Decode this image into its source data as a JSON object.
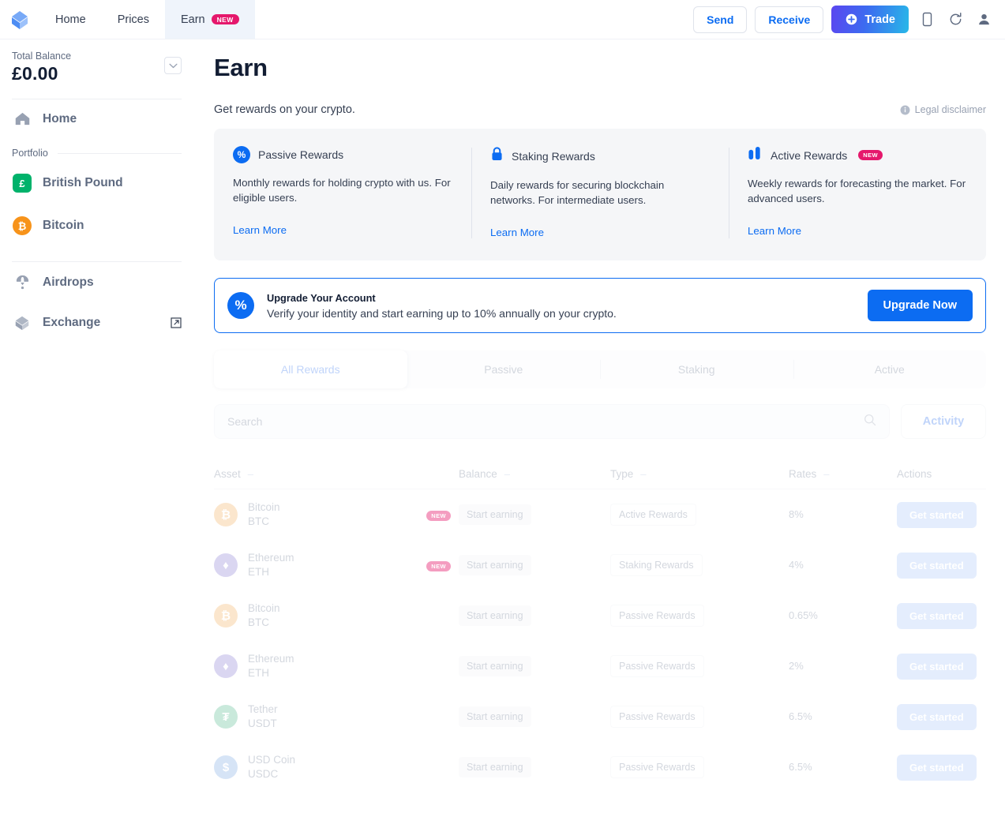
{
  "topnav": {
    "logo": "blockchain-logo",
    "links": [
      {
        "label": "Home",
        "active": false,
        "badge": ""
      },
      {
        "label": "Prices",
        "active": false,
        "badge": ""
      },
      {
        "label": "Earn",
        "active": true,
        "badge": "NEW"
      }
    ],
    "send_label": "Send",
    "receive_label": "Receive",
    "trade_label": "Trade",
    "icons": [
      "mobile-icon",
      "refresh-icon",
      "account-icon"
    ]
  },
  "sidebar": {
    "balance_label": "Total Balance",
    "balance_value": "£0.00",
    "home_label": "Home",
    "portfolio_label": "Portfolio",
    "assets": [
      {
        "label": "British Pound",
        "symbol": "£",
        "color": "#00B26B",
        "shape": "square"
      },
      {
        "label": "Bitcoin",
        "symbol": "₿",
        "color": "#F7931A",
        "shape": "circle"
      }
    ],
    "airdrops_label": "Airdrops",
    "exchange_label": "Exchange"
  },
  "main": {
    "title": "Earn",
    "subtitle": "Get rewards on your crypto.",
    "disclaimer_label": "Legal disclaimer",
    "cards": [
      {
        "icon": "percent-icon",
        "title": "Passive Rewards",
        "badge": "",
        "body": "Monthly rewards for holding crypto with us. For eligible users.",
        "link": "Learn More"
      },
      {
        "icon": "lock-icon",
        "title": "Staking Rewards",
        "badge": "",
        "body": "Daily rewards for securing blockchain networks. For intermediate users.",
        "link": "Learn More"
      },
      {
        "icon": "bars-icon",
        "title": "Active Rewards",
        "badge": "NEW",
        "body": "Weekly rewards for forecasting the market. For advanced users.",
        "link": "Learn More"
      }
    ],
    "upgrade": {
      "icon": "percent-icon",
      "title": "Upgrade Your Account",
      "subtitle": "Verify your identity and start earning up to 10% annually on your crypto.",
      "button": "Upgrade Now"
    },
    "tabs": [
      {
        "label": "All Rewards",
        "active": true
      },
      {
        "label": "Passive",
        "active": false
      },
      {
        "label": "Staking",
        "active": false
      },
      {
        "label": "Active",
        "active": false
      }
    ],
    "search": {
      "placeholder": "Search",
      "value": "",
      "icon": "search-icon"
    },
    "activity_label": "Activity",
    "table": {
      "columns": [
        {
          "label": "Asset",
          "sortable": true
        },
        {
          "label": "Balance",
          "sortable": true
        },
        {
          "label": "Type",
          "sortable": true
        },
        {
          "label": "Rates",
          "sortable": true
        },
        {
          "label": "Actions",
          "sortable": false
        }
      ],
      "sort_glyph": "–",
      "rows": [
        {
          "name": "Bitcoin",
          "symbol": "BTC",
          "glyph": "₿",
          "color": "#F7C68A",
          "badge": "NEW",
          "balance": "Start earning",
          "type": "Active Rewards",
          "rate": "8%",
          "action": "Get started"
        },
        {
          "name": "Ethereum",
          "symbol": "ETH",
          "glyph": "♦",
          "color": "#A99EE0",
          "badge": "NEW",
          "balance": "Start earning",
          "type": "Staking Rewards",
          "rate": "4%",
          "action": "Get started"
        },
        {
          "name": "Bitcoin",
          "symbol": "BTC",
          "glyph": "₿",
          "color": "#F7C68A",
          "badge": "",
          "balance": "Start earning",
          "type": "Passive Rewards",
          "rate": "0.65%",
          "action": "Get started"
        },
        {
          "name": "Ethereum",
          "symbol": "ETH",
          "glyph": "♦",
          "color": "#A99EE0",
          "badge": "",
          "balance": "Start earning",
          "type": "Passive Rewards",
          "rate": "2%",
          "action": "Get started"
        },
        {
          "name": "Tether",
          "symbol": "USDT",
          "glyph": "₮",
          "color": "#7FCBAC",
          "badge": "",
          "balance": "Start earning",
          "type": "Passive Rewards",
          "rate": "6.5%",
          "action": "Get started"
        },
        {
          "name": "USD Coin",
          "symbol": "USDC",
          "glyph": "$",
          "color": "#9FC0EC",
          "badge": "",
          "balance": "Start earning",
          "type": "Passive Rewards",
          "rate": "6.5%",
          "action": "Get started"
        }
      ]
    }
  },
  "colors": {
    "brand_blue": "#0C6CF2",
    "badge_pink": "#E5186C",
    "muted": "#98A1B2",
    "card_bg": "#F5F6F8"
  }
}
